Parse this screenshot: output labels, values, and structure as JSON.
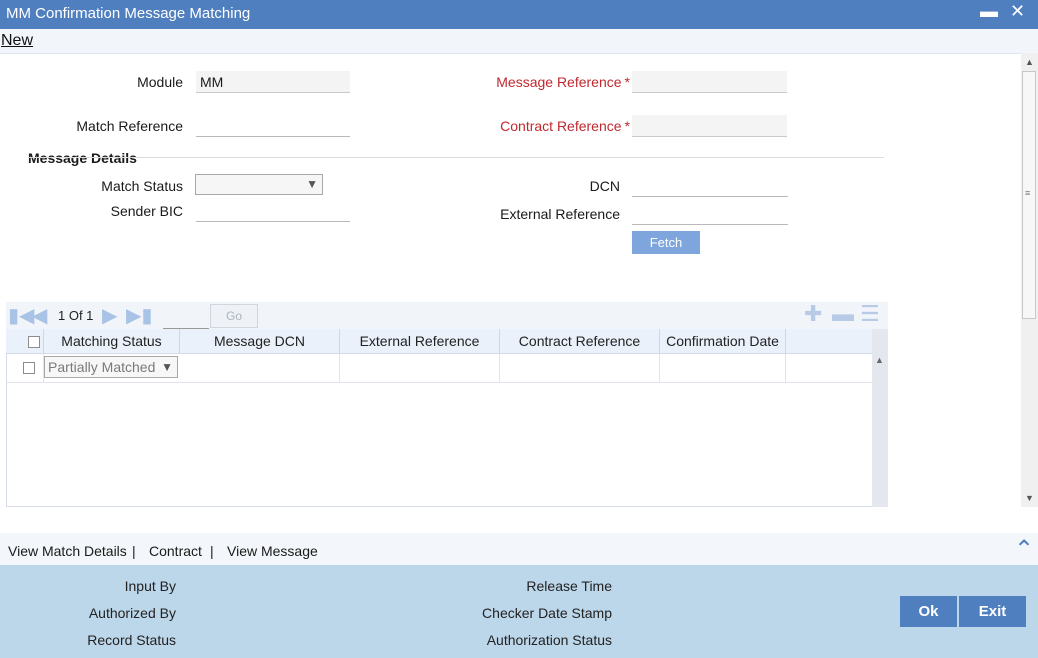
{
  "window": {
    "title": "MM Confirmation Message Matching"
  },
  "menu": {
    "new_label": "New"
  },
  "form": {
    "module_label": "Module",
    "module_value": "MM",
    "match_reference_label": "Match Reference",
    "match_reference_value": "",
    "message_reference_label": "Message Reference",
    "message_reference_value": "",
    "contract_reference_label": "Contract Reference",
    "contract_reference_value": "",
    "required_marker": "*"
  },
  "message_details": {
    "section_title": "Message Details",
    "match_status_label": "Match Status",
    "match_status_value": "",
    "sender_bic_label": "Sender BIC",
    "sender_bic_value": "",
    "dcn_label": "DCN",
    "dcn_value": "",
    "external_reference_label": "External Reference",
    "external_reference_value": "",
    "fetch_label": "Fetch"
  },
  "pager": {
    "page_text": "1 Of 1",
    "go_label": "Go"
  },
  "grid": {
    "columns": [
      "Matching Status",
      "Message DCN",
      "External Reference",
      "Contract Reference",
      "Confirmation Date"
    ],
    "rows": [
      {
        "matching_status": "Partially Matched",
        "message_dcn": "",
        "external_reference": "",
        "contract_reference": "",
        "confirmation_date": ""
      }
    ]
  },
  "links": {
    "view_match_details": "View Match Details",
    "contract": "Contract",
    "view_message": "View Message",
    "separator": "|"
  },
  "audit": {
    "input_by": "Input By",
    "authorized_by": "Authorized By",
    "record_status": "Record Status",
    "release_time": "Release Time",
    "checker_date_stamp": "Checker Date Stamp",
    "authorization_status": "Authorization Status"
  },
  "buttons": {
    "ok_label": "Ok",
    "exit_label": "Exit"
  },
  "icons": {
    "minimize": "minimize-icon",
    "close": "close-icon",
    "first": "first-page-icon",
    "prev": "prev-page-icon",
    "next": "next-page-icon",
    "last": "last-page-icon",
    "add_row": "add-row-icon",
    "delete_row": "delete-row-icon",
    "single_view": "single-record-view-icon",
    "collapse": "collapse-icon"
  },
  "colors": {
    "title_bar": "#4f7fbf",
    "required_label": "#c0282f",
    "footer": "#bcd6ea",
    "button": "#4f7fbf",
    "fetch_button": "#7ea6dd"
  }
}
